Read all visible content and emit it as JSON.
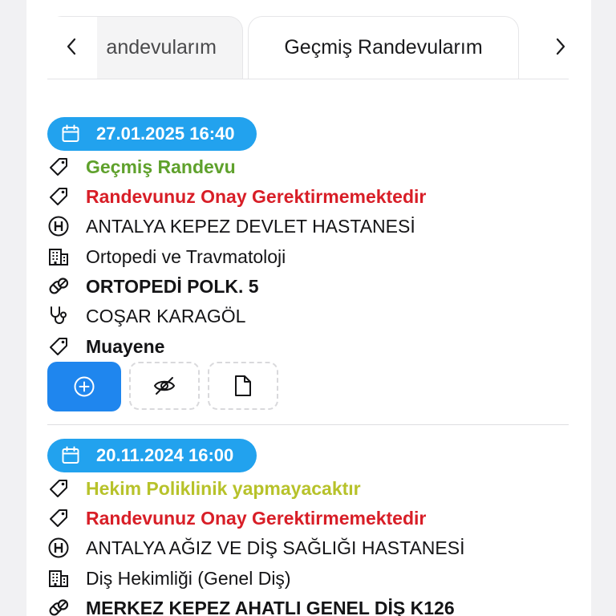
{
  "tabs": {
    "items": [
      {
        "label": "Aktif Randevularım",
        "visible_label": "andevularım",
        "active": false
      },
      {
        "label": "Geçmiş Randevularım",
        "visible_label": "Geçmiş Randevularım",
        "active": true
      }
    ],
    "prev_icon": "chevron-left-icon",
    "next_icon": "chevron-right-icon"
  },
  "appointments": [
    {
      "datetime": "27.01.2025 16:40",
      "status": "Geçmiş Randevu",
      "approval": "Randevunuz Onay Gerektirmemektedir",
      "hospital": "ANTALYA KEPEZ DEVLET HASTANESİ",
      "department": "Ortopedi ve Travmatoloji",
      "clinic": "ORTOPEDİ POLK. 5",
      "doctor": "COŞAR KARAGÖL",
      "type": "Muayene"
    },
    {
      "datetime": "20.11.2024 16:00",
      "status": "Hekim Poliklinik yapmayacaktır",
      "approval": "Randevunuz Onay Gerektirmemektedir",
      "hospital": "ANTALYA AĞIZ VE DİŞ SAĞLIĞI HASTANESİ",
      "department": "Diş Hekimliği (Genel Diş)",
      "clinic": "MERKEZ KEPEZ AHATLI GENEL DİŞ K126"
    }
  ],
  "colors": {
    "date_pill": "#22a2ee",
    "primary_button": "#1f86ee",
    "status_past": "#5fa12c",
    "status_warning": "#b7c22a",
    "approval": "#d81e27"
  }
}
